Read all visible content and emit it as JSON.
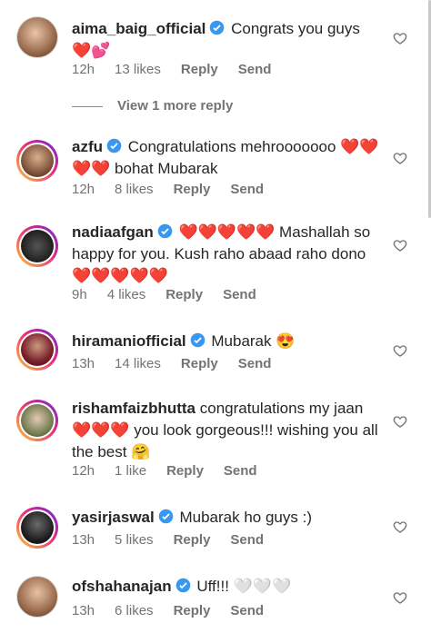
{
  "comments": [
    {
      "username": "aima_baig_official",
      "verified": true,
      "text": "Congrats you guys ❤️💕",
      "time": "12h",
      "likes": "13 likes",
      "reply": "Reply",
      "send": "Send"
    },
    {
      "username": "azfu",
      "verified": true,
      "text": "Congratulations mehrooooooo ❤️❤️❤️❤️ bohat Mubarak",
      "time": "12h",
      "likes": "8 likes",
      "reply": "Reply",
      "send": "Send"
    },
    {
      "username": "nadiaafgan",
      "verified": true,
      "text": "❤️❤️❤️❤️❤️ Mashallah so happy for you. Kush raho abaad raho dono ❤️❤️❤️❤️❤️",
      "time": "9h",
      "likes": "4 likes",
      "reply": "Reply",
      "send": "Send"
    },
    {
      "username": "hiramaniofficial",
      "verified": true,
      "text": "Mubarak 😍",
      "time": "13h",
      "likes": "14 likes",
      "reply": "Reply",
      "send": "Send"
    },
    {
      "username": "rishamfaizbhutta",
      "verified": false,
      "text": "congratulations my jaan ❤️❤️❤️ you look gorgeous!!! wishing you all the best 🤗",
      "time": "12h",
      "likes": "1 like",
      "reply": "Reply",
      "send": "Send"
    },
    {
      "username": "yasirjaswal",
      "verified": true,
      "text": "Mubarak ho guys :)",
      "time": "13h",
      "likes": "5 likes",
      "reply": "Reply",
      "send": "Send"
    },
    {
      "username": "ofshahanajan",
      "verified": true,
      "text": "Uff!!! 🤍🤍🤍",
      "time": "13h",
      "likes": "6 likes",
      "reply": "Reply",
      "send": "Send"
    }
  ],
  "view_more": "View 1 more reply",
  "colors": {
    "verified": "#3897f0",
    "heart": "#ed4956",
    "meta": "#737373"
  },
  "icons": {
    "like": "heart-outline-icon",
    "verified": "verified-badge-icon"
  }
}
